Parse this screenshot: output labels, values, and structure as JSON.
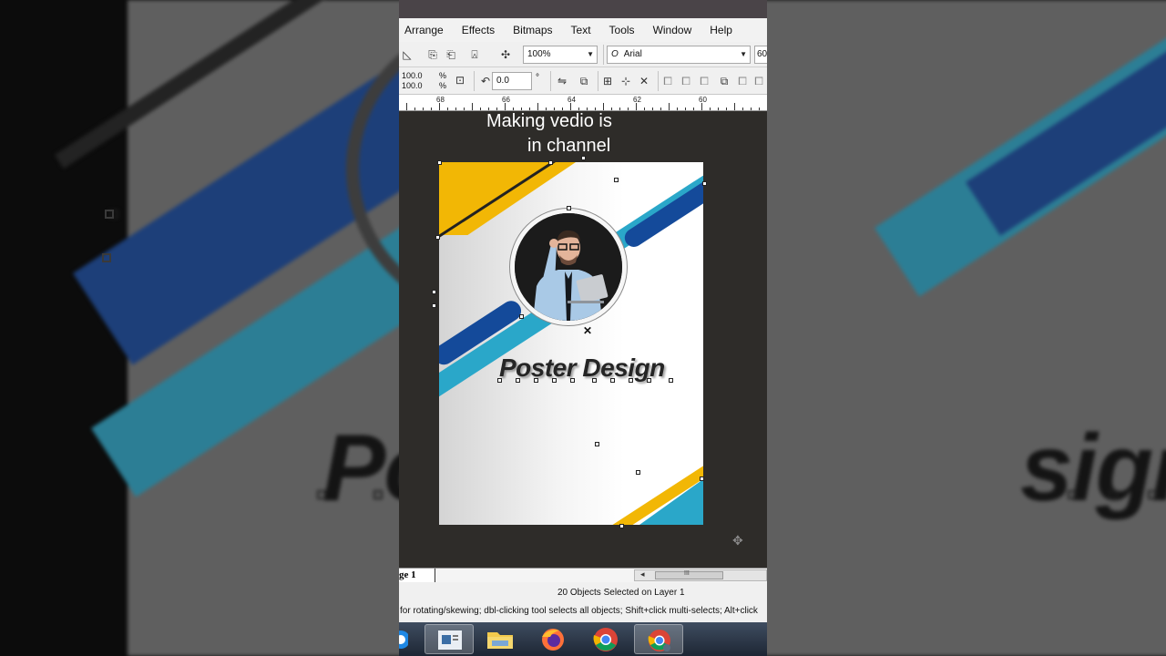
{
  "app": {
    "menu": [
      "Arrange",
      "Effects",
      "Bitmaps",
      "Text",
      "Tools",
      "Window",
      "Help"
    ],
    "zoom": "100%",
    "font_name": "Arial",
    "font_size_partial": "60",
    "scale_x": "100.0",
    "scale_y": "100.0",
    "percent_sign": "%",
    "rotation": "0.0",
    "degree_sign": "°",
    "ruler_labels": [
      "68",
      "66",
      "64",
      "62",
      "60"
    ],
    "page_tab": "ge 1",
    "scroll_grip": "III",
    "status_selected": "20 Objects Selected on Layer 1",
    "status_hint": "for rotating/skewing; dbl-clicking tool selects all objects; Shift+click multi-selects; Alt+click"
  },
  "overlay": {
    "line1": "Making vedio is",
    "line2": "in channel"
  },
  "poster": {
    "title": "Poster Design",
    "colors": {
      "yellow": "#f2b705",
      "cyan": "#2aa7c9",
      "navy": "#144a9a"
    }
  },
  "background": {
    "title_left": "Po",
    "title_right": "sign"
  },
  "taskbar": {
    "items": [
      "edge-icon",
      "slides-icon",
      "folder-icon",
      "firefox-icon",
      "chrome-icon",
      "chrome-profile-icon"
    ]
  }
}
